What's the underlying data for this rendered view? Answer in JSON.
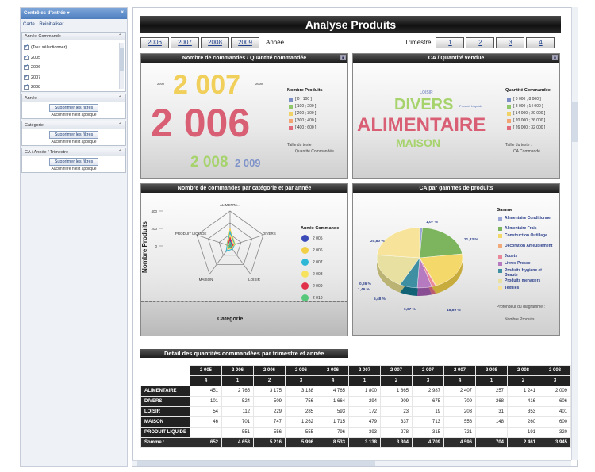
{
  "sidebar": {
    "header_title": "Contrôles d'entrée",
    "links": [
      "Carte",
      "Réinitialiser"
    ],
    "annee_commande": {
      "title": "Année Commande",
      "items": [
        "(Tout sélectionner)",
        "2005",
        "2006",
        "2007",
        "2008"
      ]
    },
    "filters": [
      {
        "title": "Année",
        "button": "Supprimer les filtres",
        "status": "Aucun filtre n'est appliqué"
      },
      {
        "title": "Catégorie",
        "button": "Supprimer les filtres",
        "status": "Aucun filtre n'est appliqué"
      },
      {
        "title": "CA / Année / Trimestre",
        "button": "Supprimer les filtres",
        "status": "Aucun filtre n'est appliqué"
      }
    ]
  },
  "header": {
    "title": "Analyse Produits"
  },
  "year_tabs": {
    "items": [
      "2006",
      "2007",
      "2008",
      "2009"
    ],
    "label": "Année"
  },
  "quarter_tabs": {
    "label": "Trimestre",
    "items": [
      "1",
      "2",
      "3",
      "4"
    ]
  },
  "panels": {
    "commandes": {
      "title": "Nombre de commandes / Quantité commandée",
      "words": [
        "2 007",
        "2 006",
        "2 008",
        "2 009"
      ],
      "small_words": [
        "2005",
        "2005"
      ],
      "legend_title": "Nombre Produits",
      "legend": [
        "[ 0 ; 100 ]",
        "[ 100 ; 200 ]",
        "[ 200 ; 300 ]",
        "[ 300 ; 400 ]",
        "[ 400 ; 600 ]"
      ],
      "note_label": "Taille du texte :",
      "note_value": "Quantité Commandée"
    },
    "ca_quantite": {
      "title": "CA / Quantité vendue",
      "words": [
        "DIVERS",
        "ALIMENTAIRE",
        "MAISON"
      ],
      "small_words": [
        "LOISIR",
        "Produit Liquide"
      ],
      "legend_title": "Quantité Commandée",
      "legend": [
        "[ 0 000 ; 8 000 ]",
        "[ 8 000 ; 14 000 ]",
        "[ 14 000 ; 20 000 ]",
        "[ 20 000 ; 26 000 ]",
        "[ 26 000 ; 32 000 ]"
      ],
      "note_label": "Taille du texte :",
      "note_value": "CA Commandé"
    },
    "radar": {
      "title": "Nombre de commandes par catégorie et par année",
      "ylabel": "Nombre Produits",
      "xlabel": "Categorie",
      "ticks": [
        "400",
        "200",
        "0"
      ],
      "axes": [
        "ALIMENTA...",
        "DIVERS",
        "LOISIR",
        "MAISON",
        "PRODUIT LIQUIDE"
      ],
      "legend_title": "Année Commande",
      "legend": [
        "2 005",
        "2 006",
        "2 007",
        "2 008",
        "2 009",
        "2 010"
      ]
    },
    "pie": {
      "title": "CA par gammes de produits",
      "legend_title": "Gamme",
      "legend": [
        "Alimentaire Conditionne",
        "Alimentaire Frais",
        "Construction Outillage",
        "Decoration Ameublement",
        "Jouets",
        "Livres Presse",
        "Produits Hygiene et Beaute",
        "Produits menagers",
        "Textiles"
      ],
      "labels": [
        "1,07 %",
        "21,83 %",
        "20,80 %",
        "0,26 %",
        "1,46 %",
        "5,48 %",
        "6,67 %",
        "18,89 %"
      ],
      "note_label": "Profondeur du diagramme :",
      "note_value": "Nombre Produits"
    }
  },
  "chart_data": [
    {
      "type": "pie",
      "title": "CA par gammes de produits",
      "categories": [
        "Alimentaire Conditionne",
        "Alimentaire Frais",
        "Construction Outillage",
        "Decoration Ameublement",
        "Jouets",
        "Livres Presse",
        "Produits Hygiene et Beaute",
        "Produits menagers",
        "Textiles"
      ],
      "values": [
        1.07,
        21.83,
        20.8,
        0.26,
        1.46,
        5.48,
        6.67,
        18.89,
        23.54
      ],
      "legend": "right"
    },
    {
      "type": "radar",
      "title": "Nombre de commandes par catégorie et par année",
      "ylabel": "Nombre Produits",
      "xlabel": "Categorie",
      "categories": [
        "ALIMENTA...",
        "DIVERS",
        "LOISIR",
        "MAISON",
        "PRODUIT LIQUIDE"
      ],
      "ylim": [
        0,
        400
      ],
      "series": [
        {
          "name": "2 005",
          "values": [
            60,
            25,
            20,
            20,
            0
          ]
        },
        {
          "name": "2 006",
          "values": [
            190,
            60,
            40,
            35,
            40
          ]
        },
        {
          "name": "2 007",
          "values": [
            160,
            55,
            45,
            75,
            35
          ]
        },
        {
          "name": "2 008",
          "values": [
            120,
            50,
            30,
            45,
            30
          ]
        },
        {
          "name": "2 009",
          "values": [
            90,
            35,
            25,
            30,
            25
          ]
        },
        {
          "name": "2 010",
          "values": [
            40,
            15,
            10,
            20,
            10
          ]
        }
      ],
      "legend": "right"
    }
  ],
  "colors": {
    "legend_5": [
      "#7b8fc6",
      "#8fc76a",
      "#f0d266",
      "#f2a572",
      "#e06a7a"
    ],
    "pie": [
      "#9aa6d6",
      "#7cb55e",
      "#f5d86a",
      "#f2a97a",
      "#e9889b",
      "#b57ac0",
      "#3f8fa3",
      "#e8e0a0",
      "#f7e49a"
    ],
    "radar": [
      "#3b4bb8",
      "#f2cf45",
      "#2fb8d6",
      "#f7e25e",
      "#e0304a",
      "#57c87a"
    ]
  },
  "table": {
    "title": "Detail des quantités commandées par trimestre et année",
    "years": [
      "2 005",
      "2 006",
      "2 006",
      "2 006",
      "2 006",
      "2 007",
      "2 007",
      "2 007",
      "2 007",
      "2 008",
      "2 008",
      "2 008"
    ],
    "quarters": [
      "4",
      "1",
      "2",
      "3",
      "4",
      "1",
      "2",
      "3",
      "4",
      "1",
      "2",
      "3"
    ],
    "rows": [
      {
        "label": "ALIMENTAIRE",
        "cells": [
          "451",
          "2 765",
          "3 175",
          "3 138",
          "4 765",
          "1 800",
          "1 865",
          "2 987",
          "2 407",
          "257",
          "1 241",
          "2 009"
        ]
      },
      {
        "label": "DIVERS",
        "cells": [
          "101",
          "524",
          "509",
          "756",
          "1 664",
          "294",
          "909",
          "675",
          "709",
          "268",
          "416",
          "606"
        ]
      },
      {
        "label": "LOISIR",
        "cells": [
          "54",
          "112",
          "229",
          "285",
          "593",
          "172",
          "23",
          "19",
          "203",
          "31",
          "353",
          "401"
        ]
      },
      {
        "label": "MAISON",
        "cells": [
          "46",
          "701",
          "747",
          "1 262",
          "1 715",
          "479",
          "337",
          "713",
          "556",
          "148",
          "260",
          "600"
        ]
      },
      {
        "label": "PRODUIT LIQUIDE",
        "cells": [
          "",
          "551",
          "556",
          "555",
          "796",
          "393",
          "278",
          "315",
          "721",
          "",
          "191",
          "320"
        ]
      },
      {
        "label": "Somme :",
        "cells": [
          "652",
          "4 653",
          "5 216",
          "5 996",
          "8 533",
          "3 138",
          "3 304",
          "4 709",
          "4 596",
          "704",
          "2 461",
          "3 945"
        ]
      }
    ]
  }
}
